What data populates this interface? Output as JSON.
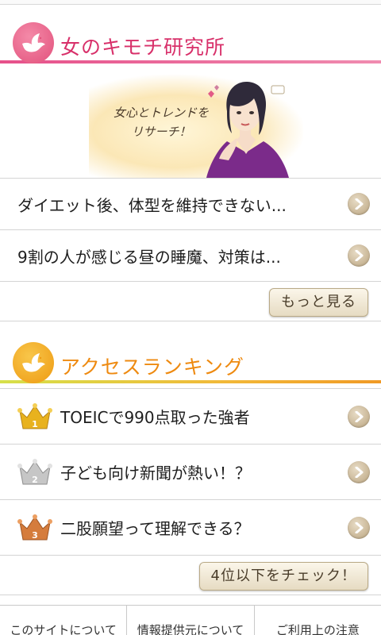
{
  "research_section": {
    "title": "女のキモチ研究所",
    "banner_catch_line1": "女心とトレンドを",
    "banner_catch_line2": "リサーチ！",
    "articles": [
      {
        "text": "ダイエット後、体型を維持できない..."
      },
      {
        "text": "9割の人が感じる昼の睡魔、対策は..."
      }
    ],
    "more_button": "もっと見る"
  },
  "ranking_section": {
    "title": "アクセスランキング",
    "items": [
      {
        "rank": "1",
        "medal": "gold-crown-icon",
        "text": "TOEICで990点取った強者"
      },
      {
        "rank": "2",
        "medal": "silver-crown-icon",
        "text": "子ども向け新聞が熱い！？"
      },
      {
        "rank": "3",
        "medal": "bronze-crown-icon",
        "text": "二股願望って理解できる？"
      }
    ],
    "check_button": "4位以下をチェック！"
  },
  "footer": {
    "links": [
      "このサイトについて",
      "情報提供元について",
      "ご利用上の注意"
    ]
  },
  "colors": {
    "research_accent": "#d8306a",
    "ranking_accent": "#ee8a10",
    "gold": "#e8b21e",
    "silver": "#b9b9b9",
    "bronze": "#d57c3c"
  }
}
